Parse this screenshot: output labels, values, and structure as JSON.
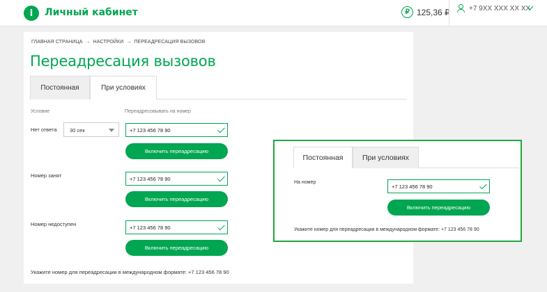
{
  "header": {
    "brand": "Личный кабинет",
    "logo_glyph": "i",
    "currency_icon": "₽",
    "balance": "125,36 ₽",
    "phone": "+7 9XX XXX XX XX"
  },
  "breadcrumb": {
    "items": [
      "ГЛАВНАЯ СТРАНИЦА",
      "НАСТРОЙКИ",
      "ПЕРЕАДРЕСАЦИЯ ВЫЗОВОВ"
    ],
    "separator": "→"
  },
  "page": {
    "title": "Переадресация вызовов",
    "tabs": [
      {
        "label": "Постоянная",
        "active": false
      },
      {
        "label": "При условиях",
        "active": true
      }
    ],
    "column_condition": "Условие",
    "column_forward": "Переадресовывать на номер",
    "rows": [
      {
        "label": "Нет ответа",
        "select_value": "30 сек",
        "number": "+7 123 456 78 90",
        "button": "Включить переадресацию"
      },
      {
        "label": "Номер занят",
        "number": "+7 123 456 78 90",
        "button": "Включить переадресацию"
      },
      {
        "label": "Номер недоступен",
        "number": "+7 123 456 78 90",
        "button": "Включить переадресацию"
      }
    ],
    "hint": "Укажите номер для переадресации в международном формате: +7 123 456 78 90"
  },
  "panel": {
    "tabs": [
      {
        "label": "Постоянная",
        "active": true
      },
      {
        "label": "При условиях",
        "active": false
      }
    ],
    "number_label": "На номер",
    "number": "+7 123 456 78 90",
    "button": "Включить переадресацию",
    "hint": "Укажите номер для переадресации в международном формате: +7 123 456 78 90"
  },
  "colors": {
    "accent": "#00a651",
    "highlight_border": "#1fa83e"
  }
}
